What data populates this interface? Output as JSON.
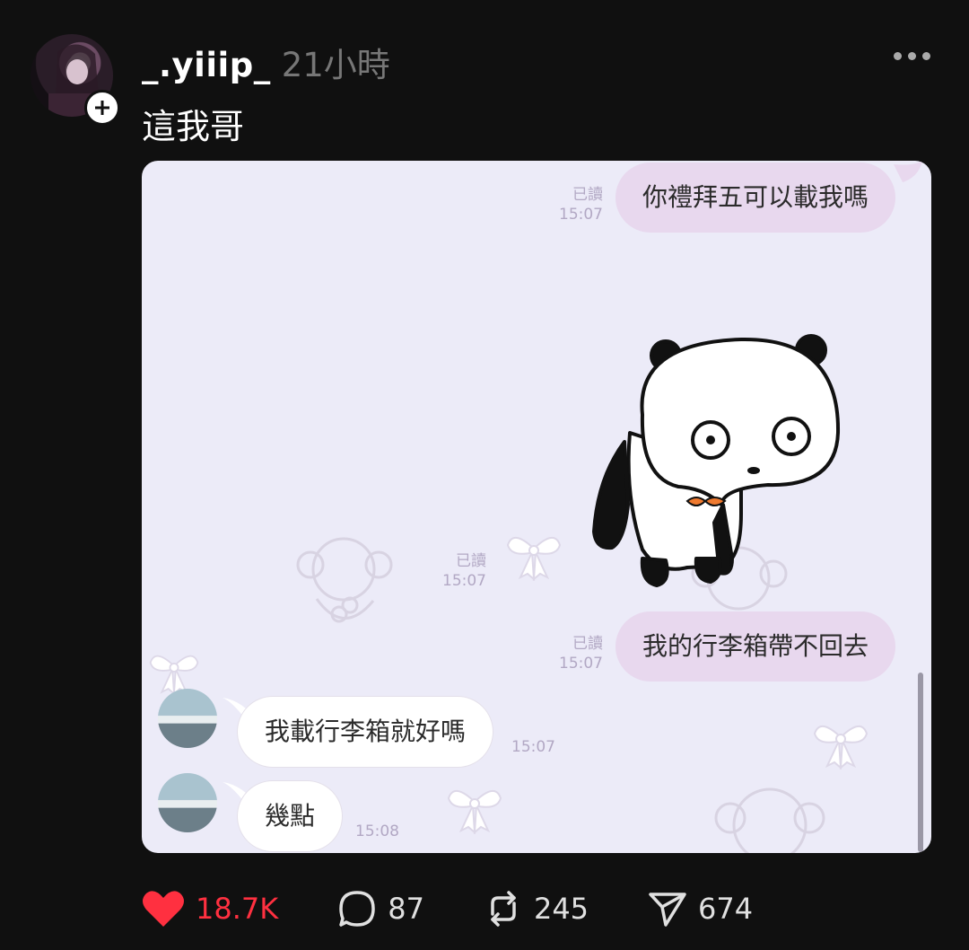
{
  "post": {
    "username": "_.yiiip_",
    "time": "21小時",
    "caption": "這我哥"
  },
  "chat": {
    "messages": [
      {
        "dir": "out",
        "text": "你禮拜五可以載我嗎",
        "read": "已讀",
        "time": "15:07"
      },
      {
        "dir": "out-sticker",
        "sticker": "panda-sticker",
        "read": "已讀",
        "time": "15:07"
      },
      {
        "dir": "out",
        "text": "我的行李箱帶不回去",
        "read": "已讀",
        "time": "15:07"
      },
      {
        "dir": "in",
        "text": "我載行李箱就好嗎",
        "time": "15:07"
      },
      {
        "dir": "in",
        "text": "幾點",
        "time": "15:08"
      }
    ]
  },
  "actions": {
    "likes": "18.7K",
    "comments": "87",
    "reposts": "245",
    "shares": "674"
  },
  "colors": {
    "like": "#ff3040",
    "bubble_out": "#e8d8ee",
    "chat_bg": "#ecebf8"
  },
  "icons": [
    "plus-icon",
    "more-icon",
    "heart-icon",
    "comment-icon",
    "repost-icon",
    "share-icon"
  ]
}
